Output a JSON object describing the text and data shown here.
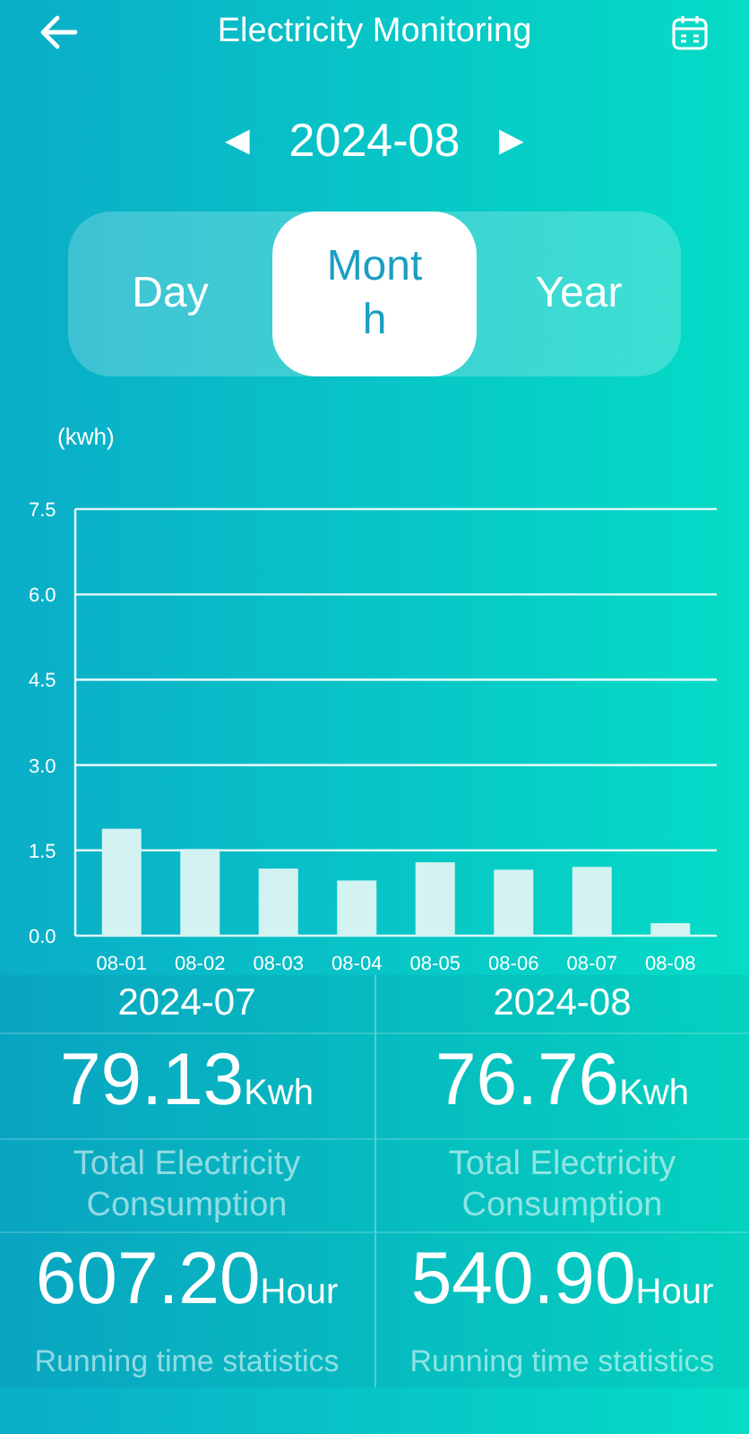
{
  "header": {
    "title": "Electricity Monitoring"
  },
  "period": {
    "prev": "◀",
    "label": "2024-08",
    "next": "▶"
  },
  "tabs": [
    {
      "label": "Day",
      "selected": false
    },
    {
      "label": "Month",
      "selected": true
    },
    {
      "label": "Year",
      "selected": false
    }
  ],
  "chart": {
    "unit_label": "(kwh)",
    "chart_data": {
      "type": "bar",
      "categories": [
        "08-01",
        "08-02",
        "08-03",
        "08-04",
        "08-05",
        "08-06",
        "08-07",
        "08-08"
      ],
      "grid": true,
      "series": [
        {
          "color": "#d2f3f2",
          "values": [
            1.88,
            1.52,
            1.18,
            0.97,
            1.29,
            1.16,
            1.21,
            0.22
          ]
        }
      ],
      "ylim": [
        0,
        7.5
      ],
      "yticks": [
        {
          "value": 0,
          "label": "0.0"
        },
        {
          "value": 1.5,
          "label": "1.5"
        },
        {
          "value": 3,
          "label": "3.0"
        },
        {
          "value": 4.5,
          "label": "4.5"
        },
        {
          "value": 6,
          "label": "6.0"
        },
        {
          "value": 7.5,
          "label": "7.5"
        }
      ]
    }
  },
  "stats": [
    {
      "period": "2024-07",
      "energy": "79.13",
      "energy_unit": "Kwh",
      "energy_label": "Total Electricity Consumption",
      "runtime": "607.20",
      "runtime_unit": "Hour",
      "runtime_label": "Running time statistics"
    },
    {
      "period": "2024-08",
      "energy": "76.76",
      "energy_unit": "Kwh",
      "energy_label": "Total Electricity Consumption",
      "runtime": "540.90",
      "runtime_unit": "Hour",
      "runtime_label": "Running time statistics"
    }
  ]
}
